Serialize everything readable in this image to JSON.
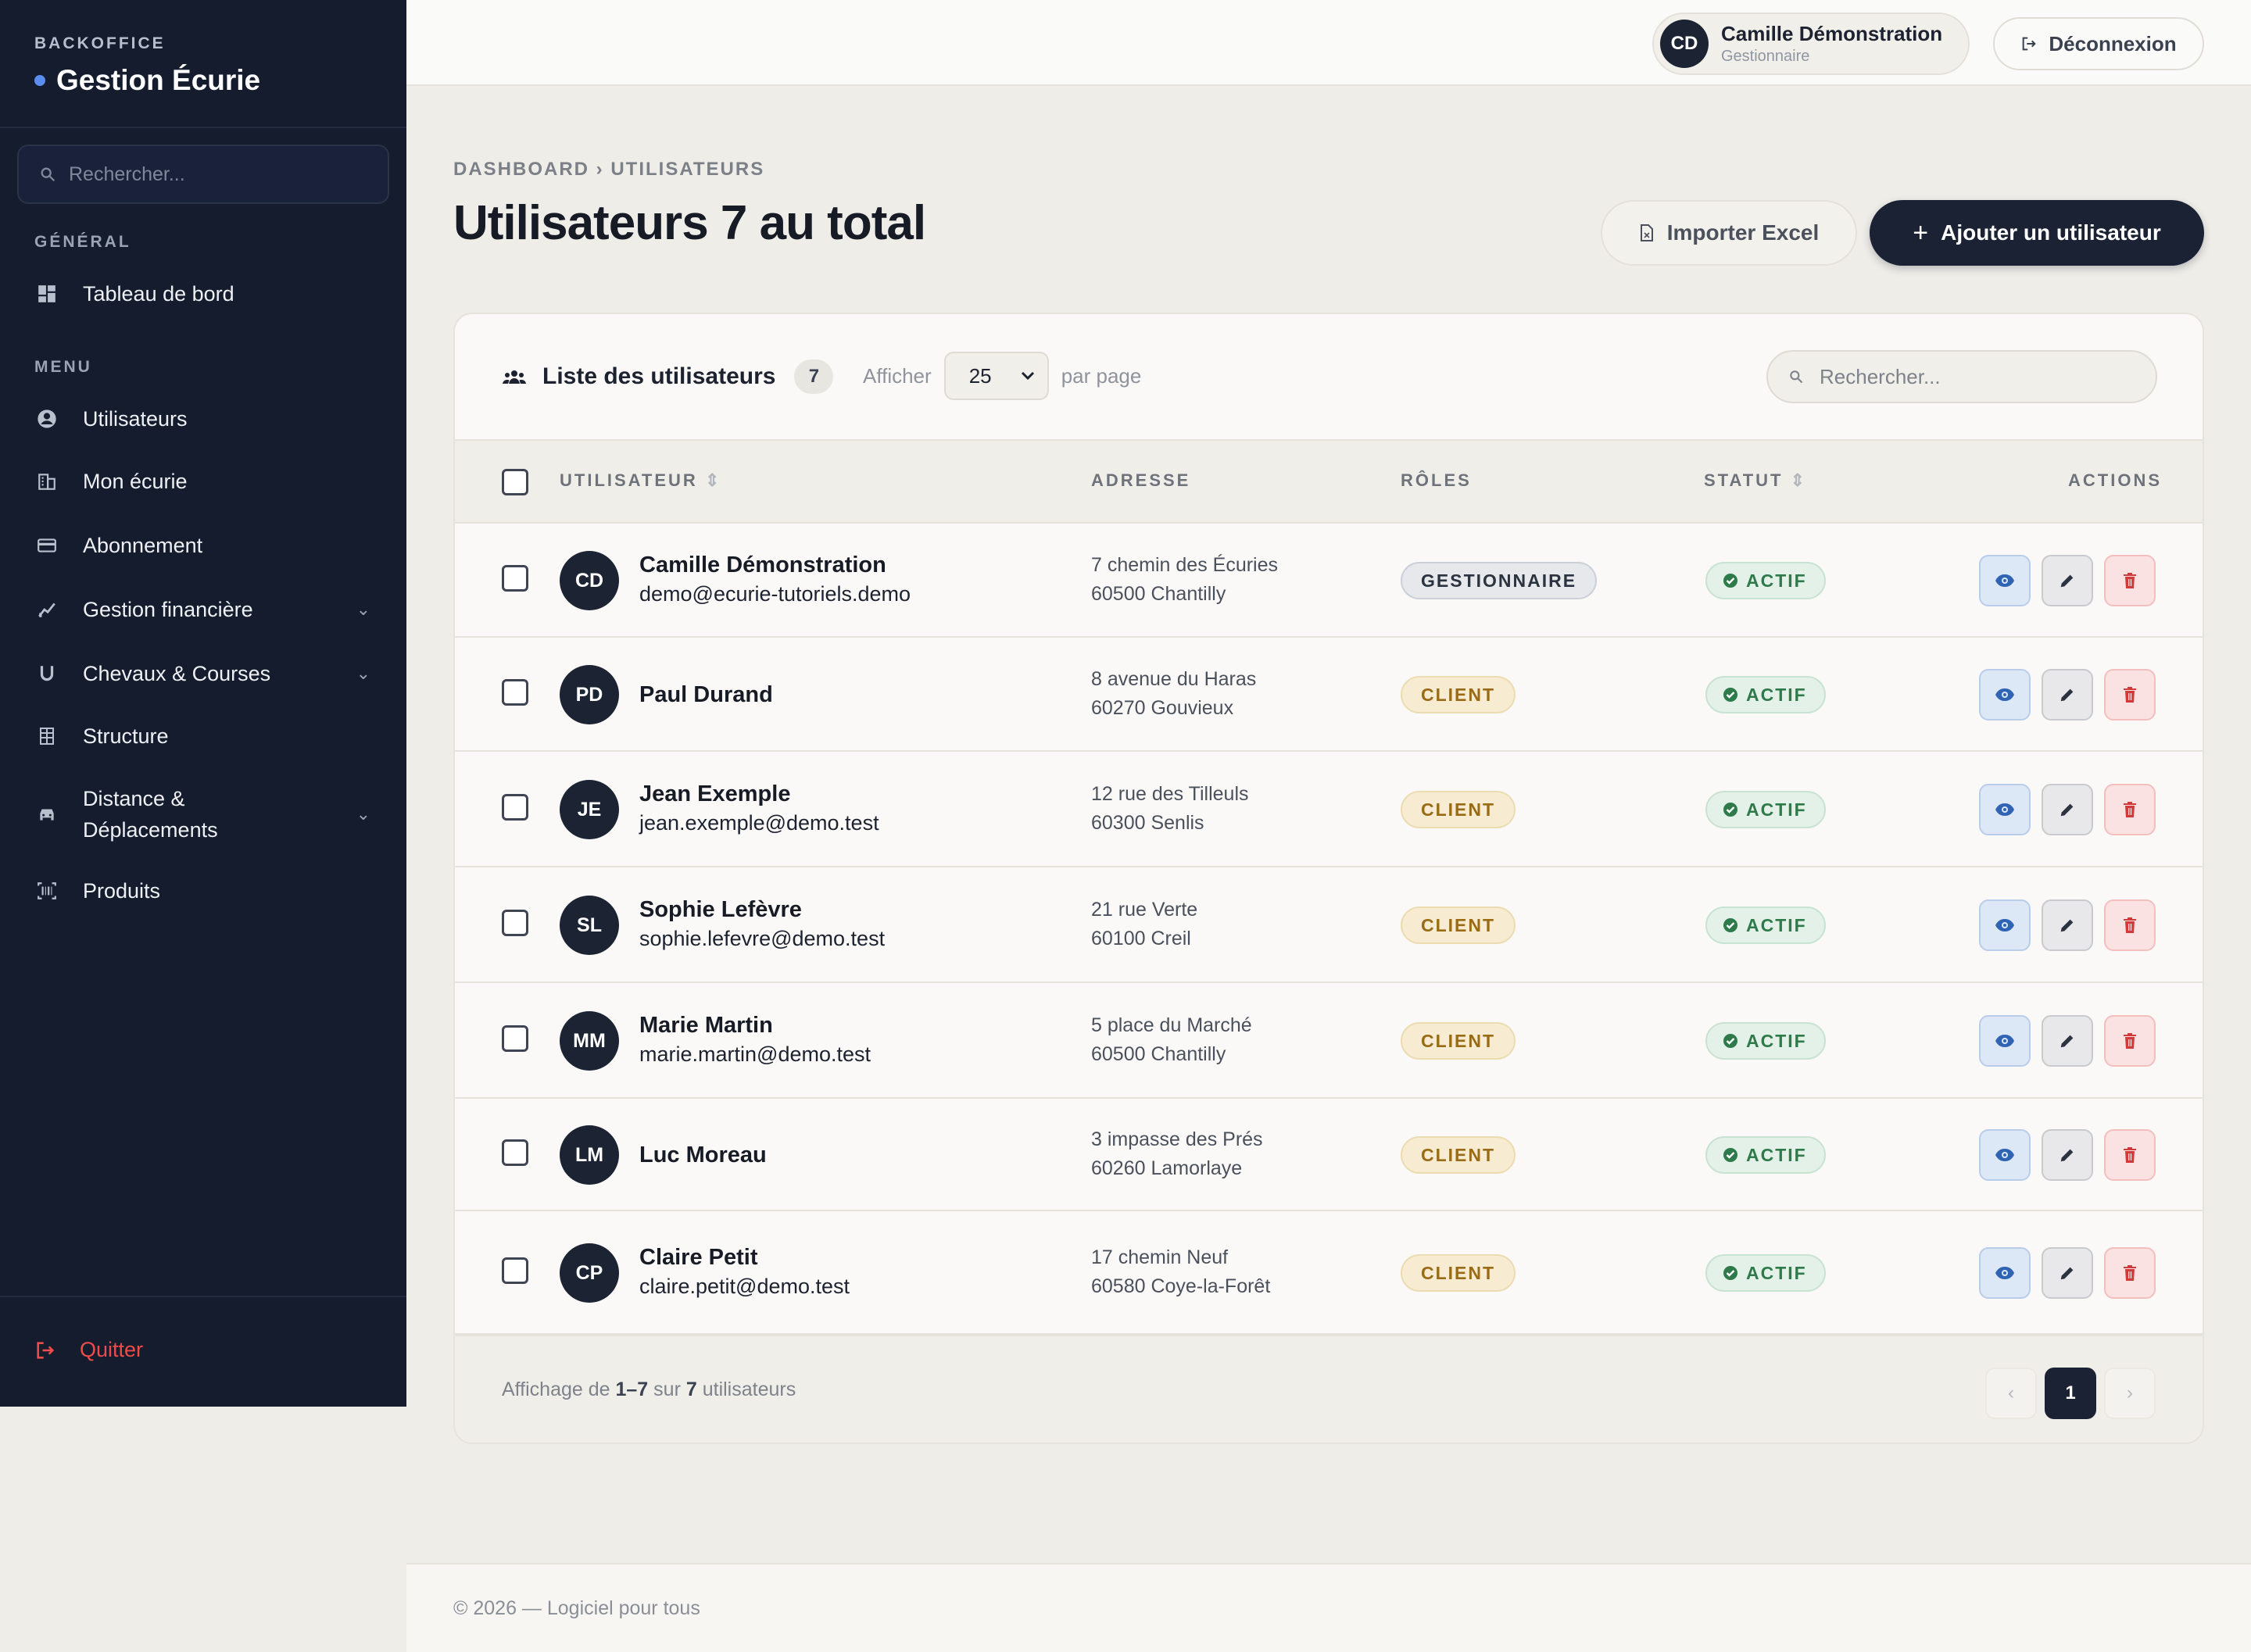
{
  "sidebar": {
    "eyebrow": "BACKOFFICE",
    "brand": "Gestion Écurie",
    "search_placeholder": "Rechercher...",
    "section_general": "GÉNÉRAL",
    "dashboard": "Tableau de bord",
    "section_menu": "MENU",
    "items": [
      {
        "label": "Utilisateurs",
        "icon": "user-circle-icon"
      },
      {
        "label": "Mon écurie",
        "icon": "building-icon"
      },
      {
        "label": "Abonnement",
        "icon": "credit-card-icon"
      },
      {
        "label": "Gestion financière",
        "icon": "finance-icon",
        "expandable": true
      },
      {
        "label": "Chevaux & Courses",
        "icon": "horseshoe-icon",
        "expandable": true
      },
      {
        "label": "Structure",
        "icon": "structure-icon"
      },
      {
        "label": "Distance & Déplacements",
        "icon": "car-icon",
        "expandable": true
      },
      {
        "label": "Produits",
        "icon": "barcode-icon"
      }
    ],
    "quit": "Quitter"
  },
  "topbar": {
    "user_initials": "CD",
    "user_name": "Camille Démonstration",
    "user_role": "Gestionnaire",
    "logout": "Déconnexion"
  },
  "header": {
    "breadcrumb": "DASHBOARD › UTILISATEURS",
    "title": "Utilisateurs 7 au total",
    "import_label": "Importer Excel",
    "add_label": "Ajouter un utilisateur"
  },
  "list": {
    "title": "Liste des utilisateurs",
    "count": "7",
    "show_label": "Afficher",
    "per_page_value": "25",
    "per_page_suffix": "par page",
    "search_placeholder": "Rechercher...",
    "columns": {
      "user": "UTILISATEUR",
      "address": "ADRESSE",
      "roles": "RÔLES",
      "status": "STATUT",
      "actions": "ACTIONS"
    },
    "rows": [
      {
        "initials": "CD",
        "name": "Camille Démonstration",
        "email": "demo@ecurie-tutoriels.demo",
        "addr1": "7 chemin des Écuries",
        "addr2": "60500 Chantilly",
        "role": "GESTIONNAIRE",
        "status": "ACTIF"
      },
      {
        "initials": "PD",
        "name": "Paul Durand",
        "email": "",
        "addr1": "8 avenue du Haras",
        "addr2": "60270 Gouvieux",
        "role": "CLIENT",
        "status": "ACTIF"
      },
      {
        "initials": "JE",
        "name": "Jean Exemple",
        "email": "jean.exemple@demo.test",
        "addr1": "12 rue des Tilleuls",
        "addr2": "60300 Senlis",
        "role": "CLIENT",
        "status": "ACTIF"
      },
      {
        "initials": "SL",
        "name": "Sophie Lefèvre",
        "email": "sophie.lefevre@demo.test",
        "addr1": "21 rue Verte",
        "addr2": "60100 Creil",
        "role": "CLIENT",
        "status": "ACTIF"
      },
      {
        "initials": "MM",
        "name": "Marie Martin",
        "email": "marie.martin@demo.test",
        "addr1": "5 place du Marché",
        "addr2": "60500 Chantilly",
        "role": "CLIENT",
        "status": "ACTIF"
      },
      {
        "initials": "LM",
        "name": "Luc Moreau",
        "email": "",
        "addr1": "3 impasse des Prés",
        "addr2": "60260 Lamorlaye",
        "role": "CLIENT",
        "status": "ACTIF"
      },
      {
        "initials": "CP",
        "name": "Claire Petit",
        "email": "claire.petit@demo.test",
        "addr1": "17 chemin Neuf",
        "addr2": "60580 Coye-la-Forêt",
        "role": "CLIENT",
        "status": "ACTIF"
      }
    ],
    "footer": {
      "prefix": "Affichage de",
      "range": "1–7",
      "mid": "sur",
      "total": "7",
      "suffix": "utilisateurs"
    },
    "current_page": "1"
  },
  "footer": {
    "copyright": "© 2026 — Logiciel pour tous"
  },
  "colors": {
    "sidebar_bg": "#141c2e",
    "primary": "#1a2233",
    "danger": "#d23a3a",
    "success": "#2f7a4a",
    "client_badge": "#9a6a14"
  }
}
